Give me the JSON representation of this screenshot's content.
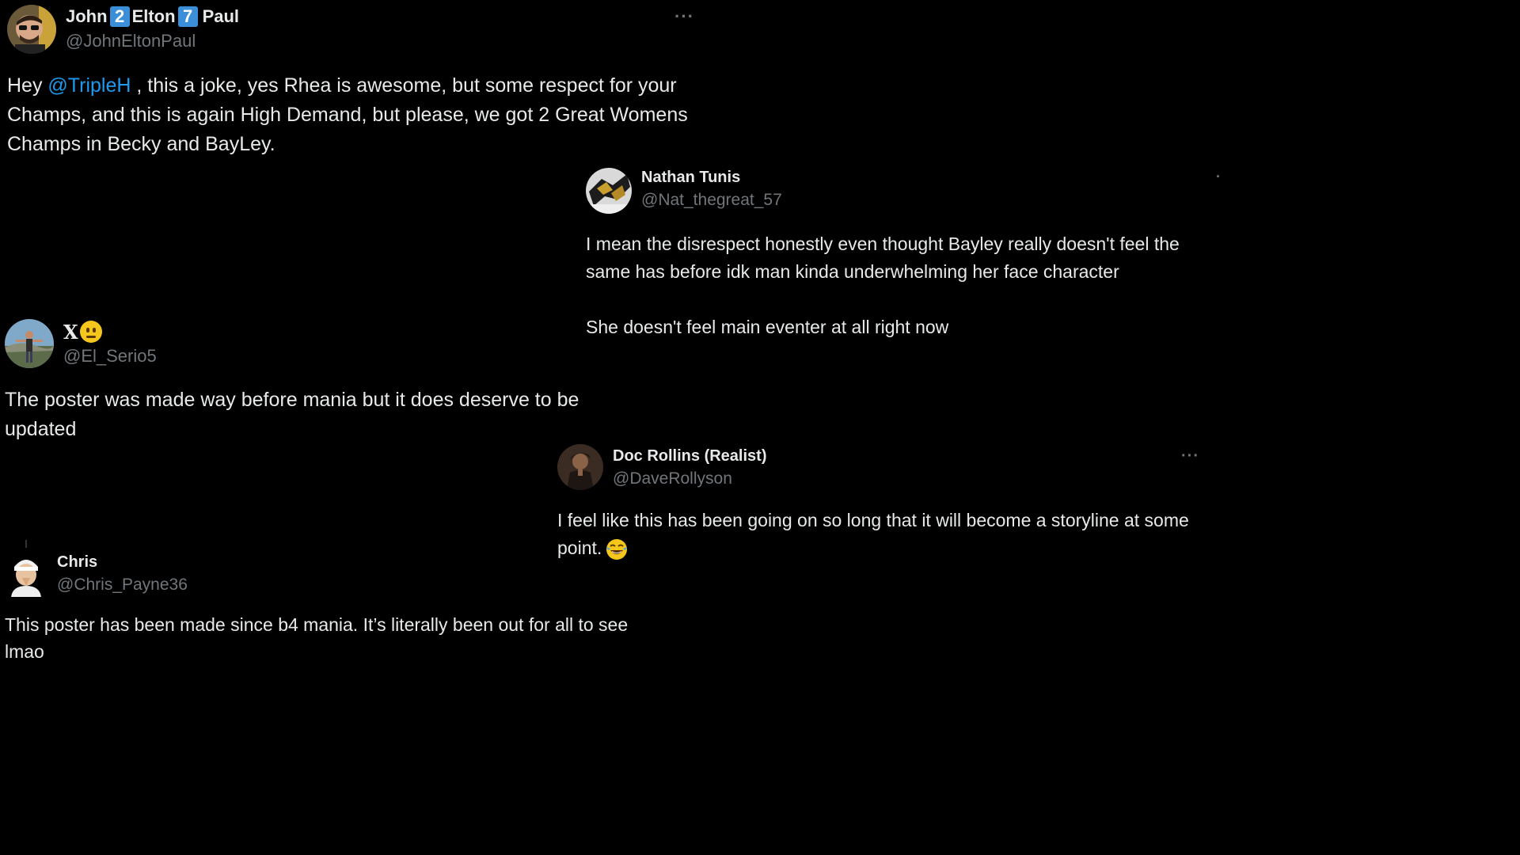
{
  "tweets": [
    {
      "name_parts": [
        "John",
        "2",
        "Elton",
        "7",
        "Paul"
      ],
      "handle": "@JohnEltonPaul",
      "more": "···",
      "text_before_mention": "Hey ",
      "mention": "@TripleH",
      "text_after_mention": " , this a joke, yes Rhea is awesome, but some respect for your Champs, and this is again High Demand, but please, we got 2 Great Womens Champs in Becky and BayLey."
    },
    {
      "name": "Nathan Tunis",
      "handle": "@Nat_thegreat_57",
      "more": "·",
      "paragraphs": [
        "I mean the disrespect honestly even thought Bayley really doesn't feel the same has before idk man kinda underwhelming her face character",
        "She doesn't feel main eventer at all right now"
      ]
    },
    {
      "name": "X",
      "name_emoji": "neutral-face-emoji",
      "handle": "@El_Serio5",
      "text": "The poster was made way before mania but it does deserve to be updated"
    },
    {
      "name": "Doc Rollins (Realist)",
      "handle": "@DaveRollyson",
      "more": "···",
      "text": "I feel like this has been going on so long that it will become a storyline at some point.",
      "emoji": "face-with-tears-of-joy-emoji"
    },
    {
      "name": "Chris",
      "handle": "@Chris_Payne36",
      "text": "This poster has been made since b4 mania. It’s literally been out for all to see lmao"
    }
  ],
  "colors": {
    "background": "#000000",
    "text": "#e7e9ea",
    "secondary": "#71767b",
    "mention": "#1d9bf0",
    "badge": "#3b8ed8"
  }
}
